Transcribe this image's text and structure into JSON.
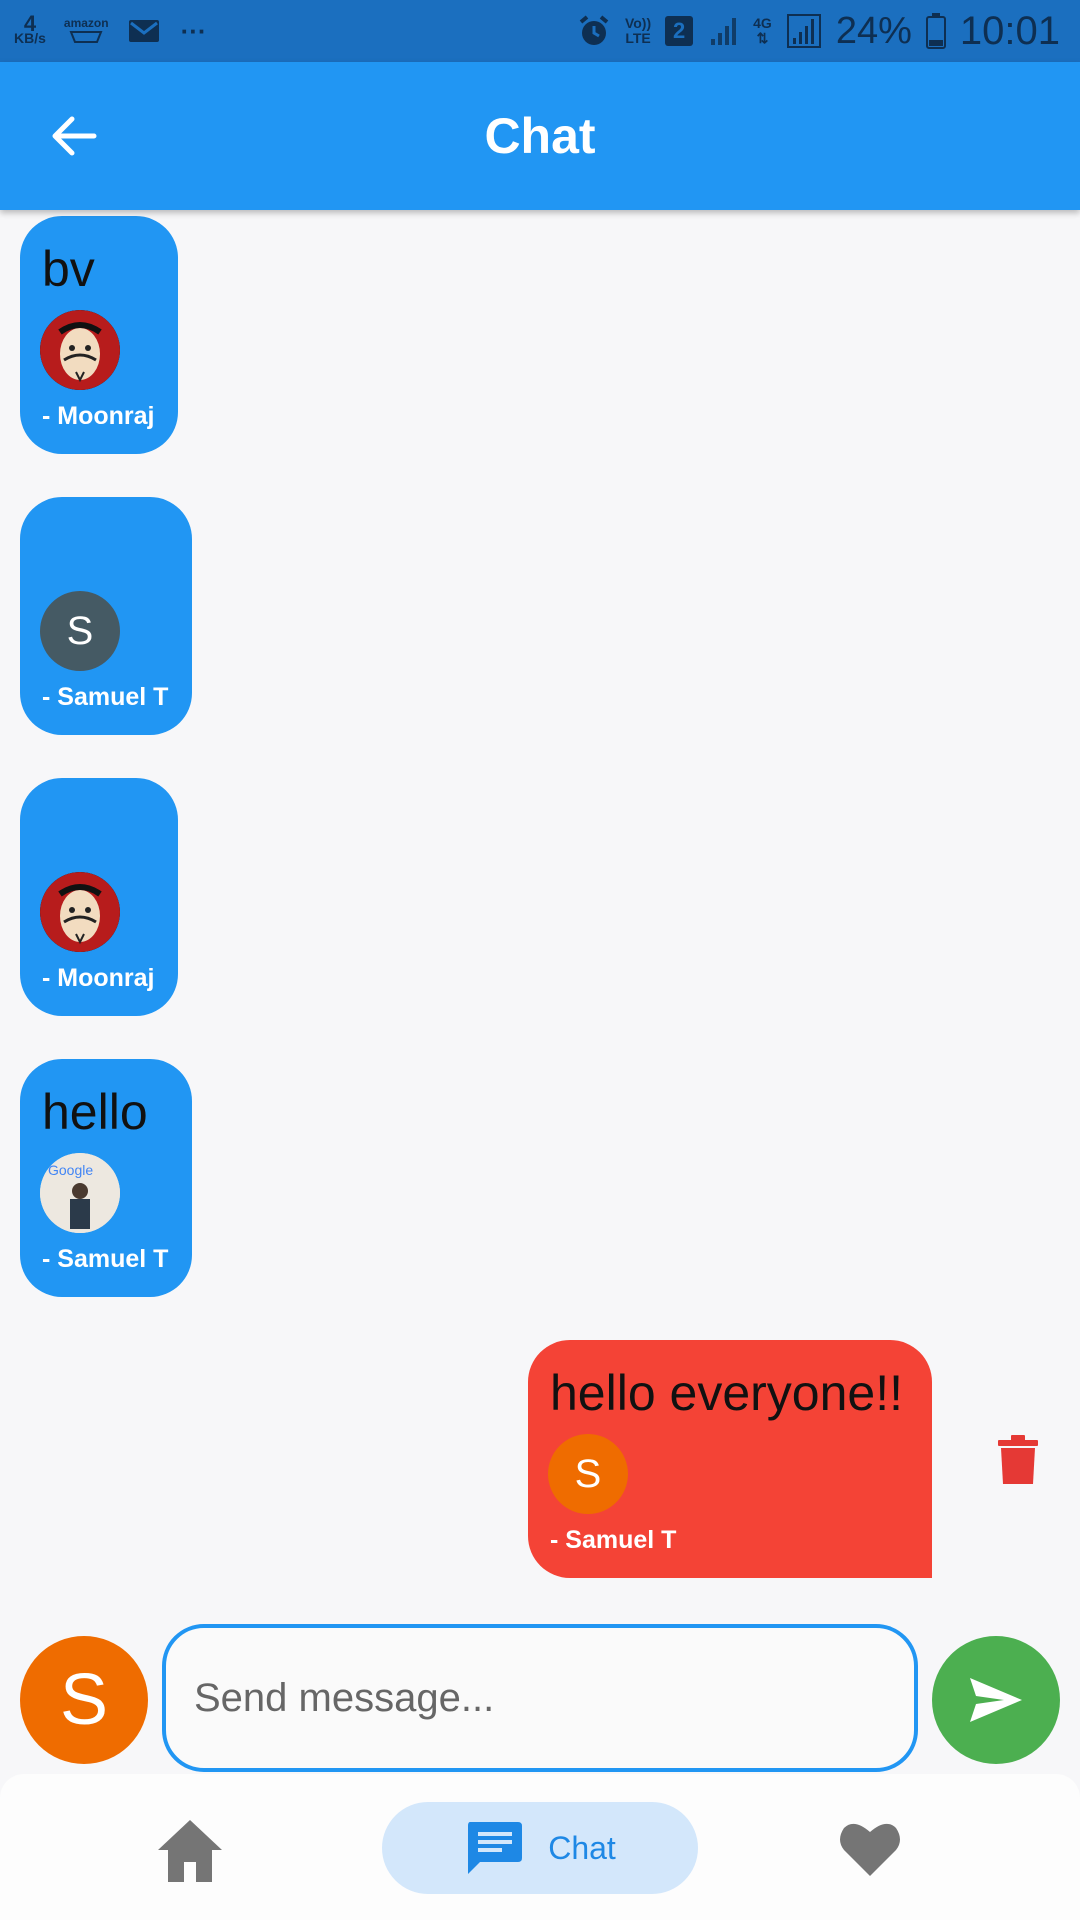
{
  "status_bar": {
    "net_speed_value": "4",
    "net_speed_unit": "KB/s",
    "amazon_label": "amazon",
    "more": "···",
    "volte_top": "Vo))",
    "volte_bottom": "LTE",
    "sim_slot": "2",
    "network_type": "4G",
    "battery_percent": "24%",
    "time": "10:01"
  },
  "app_bar": {
    "title": "Chat"
  },
  "messages": [
    {
      "text": "bv",
      "author": "- Moonraj",
      "avatar": "money-heist-mask",
      "direction": "received"
    },
    {
      "text": "",
      "author": "- Samuel T",
      "avatar_letter": "S",
      "avatar_color": "#455a64",
      "direction": "received"
    },
    {
      "text": "",
      "author": "- Moonraj",
      "avatar": "money-heist-mask",
      "direction": "received"
    },
    {
      "text": "hello",
      "author": "- Samuel T",
      "avatar": "photo-google-sign",
      "avatar_photo_text": "Google",
      "direction": "received"
    },
    {
      "text": "hello everyone!!",
      "author": "- Samuel T",
      "avatar_letter": "S",
      "avatar_color": "#ef6c00",
      "direction": "sent"
    }
  ],
  "composer": {
    "avatar_letter": "S",
    "placeholder": "Send message..."
  },
  "bottom_nav": {
    "items": [
      {
        "icon": "home-icon",
        "label": ""
      },
      {
        "icon": "chat-icon",
        "label": "Chat",
        "active": true
      },
      {
        "icon": "heart-icon",
        "label": ""
      }
    ]
  },
  "colors": {
    "primary": "#2196f3",
    "sent_bubble": "#f44336",
    "send_button": "#4caf50",
    "delete_icon": "#e53935",
    "nav_active_bg": "#d3e7fb"
  }
}
